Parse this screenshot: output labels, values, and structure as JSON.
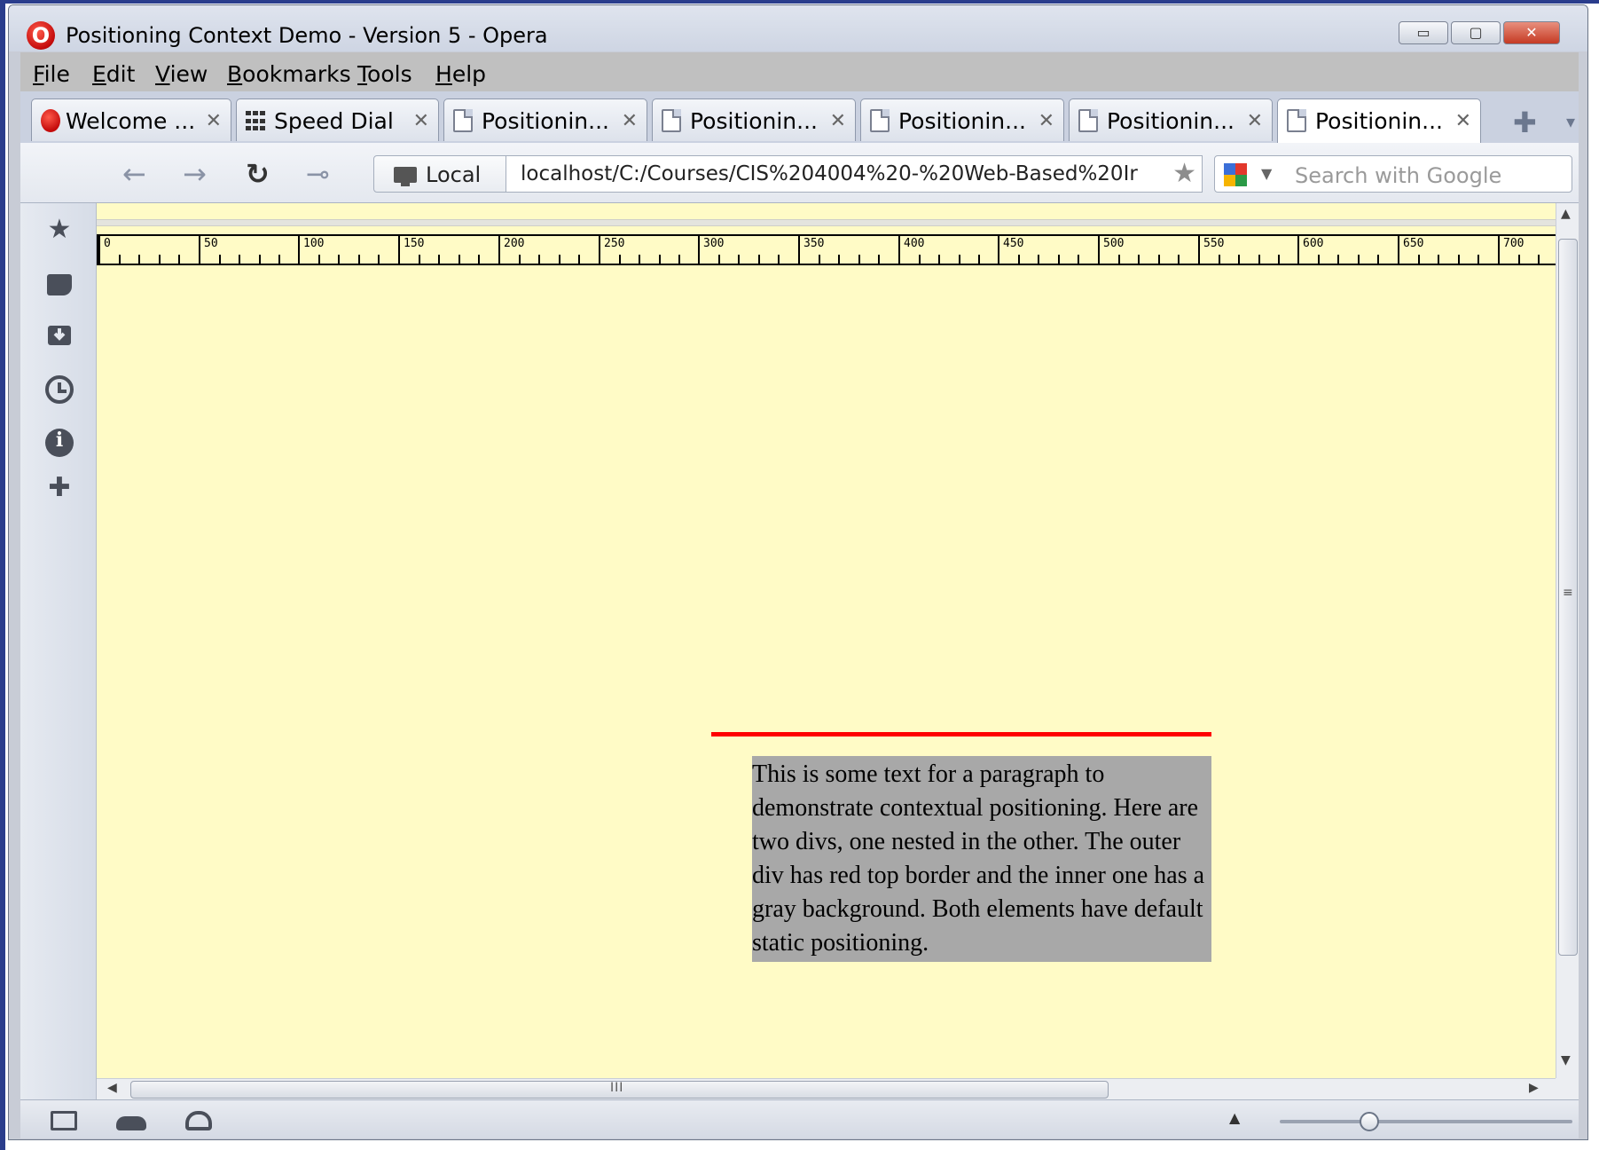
{
  "window": {
    "title": "Positioning Context Demo - Version 5 - Opera",
    "logo_letter": "O",
    "controls": {
      "minimize": "▭",
      "maximize": "▢",
      "close": "✕"
    }
  },
  "menu": [
    {
      "underline": "F",
      "rest": "ile"
    },
    {
      "underline": "E",
      "rest": "dit"
    },
    {
      "underline": "V",
      "rest": "iew"
    },
    {
      "underline": "B",
      "rest": "ookmarks"
    },
    {
      "underline": "T",
      "rest": "ools"
    },
    {
      "underline": "H",
      "rest": "elp"
    }
  ],
  "tabs": [
    {
      "label": "Welcome ...",
      "icon": "opera-icon",
      "active": false
    },
    {
      "label": "Speed Dial",
      "icon": "speed-dial-icon",
      "active": false
    },
    {
      "label": "Positionin...",
      "icon": "page-icon",
      "active": false
    },
    {
      "label": "Positionin...",
      "icon": "page-icon",
      "active": false
    },
    {
      "label": "Positionin...",
      "icon": "page-icon",
      "active": false
    },
    {
      "label": "Positionin...",
      "icon": "page-icon",
      "active": false
    },
    {
      "label": "Positionin...",
      "icon": "page-icon",
      "active": true
    }
  ],
  "tab_close_glyph": "✕",
  "new_tab_glyph": "✚",
  "tab_menu_glyph": "▾",
  "nav": {
    "back_glyph": "←",
    "forward_glyph": "→",
    "reload_glyph": "↻",
    "key_glyph": "⊸",
    "security_label": "Local",
    "url": "localhost/C:/Courses/CIS%204004%20-%20Web-Based%20Ir",
    "bookmark_glyph": "★",
    "search_placeholder": "Search with Google",
    "search_dropdown_glyph": "▼"
  },
  "ruler": {
    "labels": [
      "0",
      "50",
      "100",
      "150",
      "200",
      "250",
      "300",
      "350",
      "400",
      "450",
      "500",
      "550",
      "600",
      "650",
      "700"
    ]
  },
  "page": {
    "paragraph": "This is some text for a paragraph to demonstrate contextual positioning. Here are two divs, one nested in the other. The outer div has red top border and the inner one has a gray background. Both elements have default static positioning.",
    "outer_border_color": "#ff0000",
    "inner_background": "#a8a8a8",
    "page_background": "#fffbc6"
  },
  "scrollbars": {
    "up_arrow": "▲",
    "down_arrow": "▼",
    "left_arrow": "◀",
    "right_arrow": "▶",
    "grip_v": "≡",
    "grip_h": "III"
  },
  "sidebar": {
    "icons": [
      "star-icon",
      "notes-icon",
      "downloads-icon",
      "history-icon",
      "info-icon",
      "add-panel-icon"
    ],
    "star_glyph": "★",
    "info_glyph": "i",
    "add_glyph": "✚"
  },
  "status": {
    "zoom_up_glyph": "▲"
  }
}
